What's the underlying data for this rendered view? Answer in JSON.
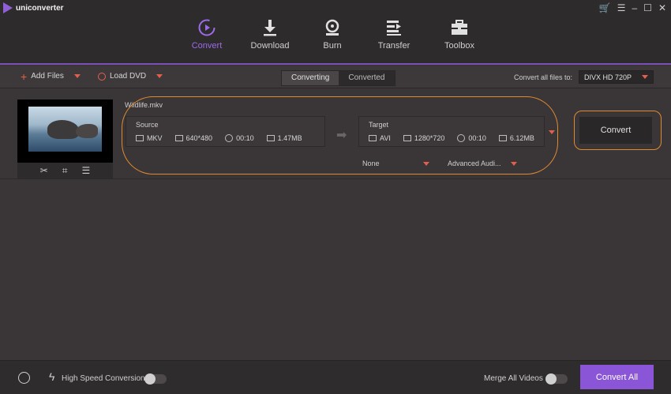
{
  "app": {
    "title": "uniconverter"
  },
  "window": {
    "cart_icon": "cart-icon",
    "list_icon": "list-icon",
    "min_icon": "minimize-icon",
    "max_icon": "maximize-icon",
    "close_icon": "close-icon"
  },
  "nav": {
    "items": [
      {
        "label": "Convert",
        "icon": "convert-icon",
        "active": true
      },
      {
        "label": "Download",
        "icon": "download-icon"
      },
      {
        "label": "Burn",
        "icon": "burn-icon"
      },
      {
        "label": "Transfer",
        "icon": "transfer-icon"
      },
      {
        "label": "Toolbox",
        "icon": "toolbox-icon"
      }
    ]
  },
  "toolbar": {
    "add_files": "Add Files",
    "load_dvd": "Load DVD",
    "tabs": [
      "Converting",
      "Converted"
    ],
    "convert_all_to_label": "Convert all files to:",
    "format": "DIVX HD 720P"
  },
  "file": {
    "name": "Wildlife.mkv",
    "source": {
      "title": "Source",
      "format": "MKV",
      "resolution": "640*480",
      "duration": "00:10",
      "size": "1.47MB"
    },
    "target": {
      "title": "Target",
      "format": "AVI",
      "resolution": "1280*720",
      "duration": "00:10",
      "size": "6.12MB"
    },
    "subtitle_select": "None",
    "audio_select": "Advanced Audi...",
    "convert_label": "Convert"
  },
  "bottom": {
    "high_speed_label": "High Speed Conversion",
    "merge_label": "Merge All Videos",
    "convert_all_label": "Convert All"
  },
  "colors": {
    "accent": "#8a55d6",
    "highlight": "#e08a30",
    "dropdown_caret": "#e2604b"
  }
}
